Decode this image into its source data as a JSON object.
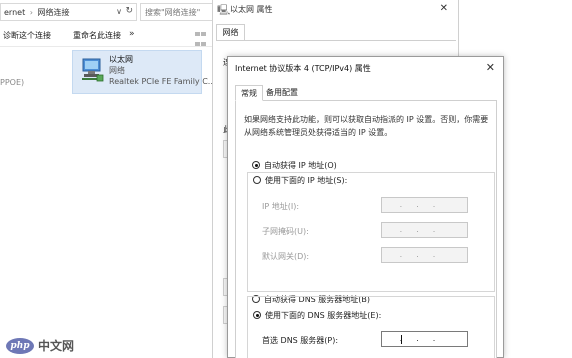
{
  "explorer": {
    "address": {
      "part1": "ernet",
      "sep": "›",
      "part2": "网络连接",
      "dropdown": "∨",
      "refresh": "↻"
    },
    "search_placeholder": "搜索\"网络连接\"",
    "toolbar": {
      "cmd1": "诊断这个连接",
      "cmd2": "重命名此连接",
      "more": "»"
    },
    "left_cut_text": "PPOE)",
    "item": {
      "name": "以太网",
      "status": "网络",
      "adapter": "Realtek PCIe FE Family C..."
    }
  },
  "properties_window": {
    "title": "以太网 属性",
    "close": "✕",
    "tab": "网络",
    "cut_labels": {
      "a": "连",
      "b": "此",
      "c": "配"
    }
  },
  "dialog": {
    "title": "Internet 协议版本 4 (TCP/IPv4) 属性",
    "close": "✕",
    "tabs": {
      "general": "常规",
      "alternate": "备用配置"
    },
    "description": "如果网络支持此功能，则可以获取自动指派的 IP 设置。否则，你需要从网络系统管理员处获得适当的 IP 设置。",
    "ip": {
      "auto_label": "自动获得 IP 地址(O)",
      "auto_selected": true,
      "manual_label": "使用下面的 IP 地址(S):",
      "fields": [
        {
          "label": "IP 地址(I):",
          "dots": "...",
          "enabled": false
        },
        {
          "label": "子网掩码(U):",
          "dots": "...",
          "enabled": false
        },
        {
          "label": "默认网关(D):",
          "dots": "...",
          "enabled": false
        }
      ]
    },
    "dns": {
      "auto_label": "自动获得 DNS 服务器地址(B)",
      "manual_label": "使用下面的 DNS 服务器地址(E):",
      "manual_selected": true,
      "preferred_label": "首选 DNS 服务器(P):",
      "preferred_dots": "..."
    }
  },
  "watermark": {
    "logo": "php",
    "text": "中文网"
  }
}
